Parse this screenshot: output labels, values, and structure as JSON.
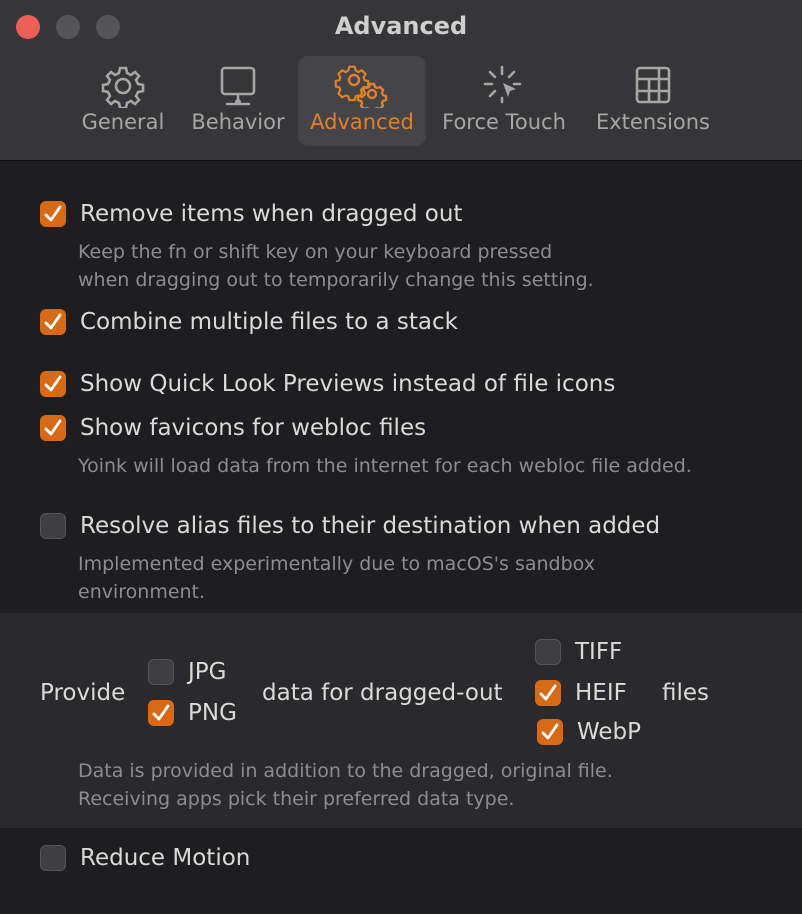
{
  "window": {
    "title": "Advanced"
  },
  "tabs": [
    {
      "label": "General",
      "icon": "gear-icon"
    },
    {
      "label": "Behavior",
      "icon": "monitor-icon"
    },
    {
      "label": "Advanced",
      "icon": "gears-icon",
      "selected": true
    },
    {
      "label": "Force Touch",
      "icon": "cursor-click-icon"
    },
    {
      "label": "Extensions",
      "icon": "grid-icon"
    }
  ],
  "options": {
    "remove_items": {
      "label": "Remove items when dragged out",
      "checked": true,
      "help1": "Keep the fn or shift key on your keyboard pressed",
      "help2": "when dragging out to temporarily change this setting."
    },
    "combine": {
      "label": "Combine multiple files to a stack",
      "checked": true
    },
    "quicklook": {
      "label": "Show Quick Look Previews instead of file icons",
      "checked": true
    },
    "favicons": {
      "label": "Show favicons for webloc files",
      "checked": true,
      "help": "Yoink will load data from the internet for each webloc file added."
    },
    "alias": {
      "label": "Resolve alias files to their destination when added",
      "checked": false,
      "help1": "Implemented experimentally due to macOS's sandbox",
      "help2": "environment."
    }
  },
  "provide": {
    "prefix": "Provide",
    "middle": "data for dragged-out",
    "suffix": "files",
    "formats": {
      "jpg": {
        "label": "JPG",
        "checked": false
      },
      "png": {
        "label": "PNG",
        "checked": true
      },
      "tiff": {
        "label": "TIFF",
        "checked": false
      },
      "heif": {
        "label": "HEIF",
        "checked": true
      },
      "webp": {
        "label": "WebP",
        "checked": true
      }
    },
    "help1": "Data is provided in addition to the dragged, original file.",
    "help2": "Receiving apps pick their preferred data type."
  },
  "reduce_motion": {
    "label": "Reduce Motion",
    "checked": false
  },
  "colors": {
    "accent": "#d76a17",
    "selected_tab_text": "#e0802a",
    "background": "#1e1d1f"
  }
}
